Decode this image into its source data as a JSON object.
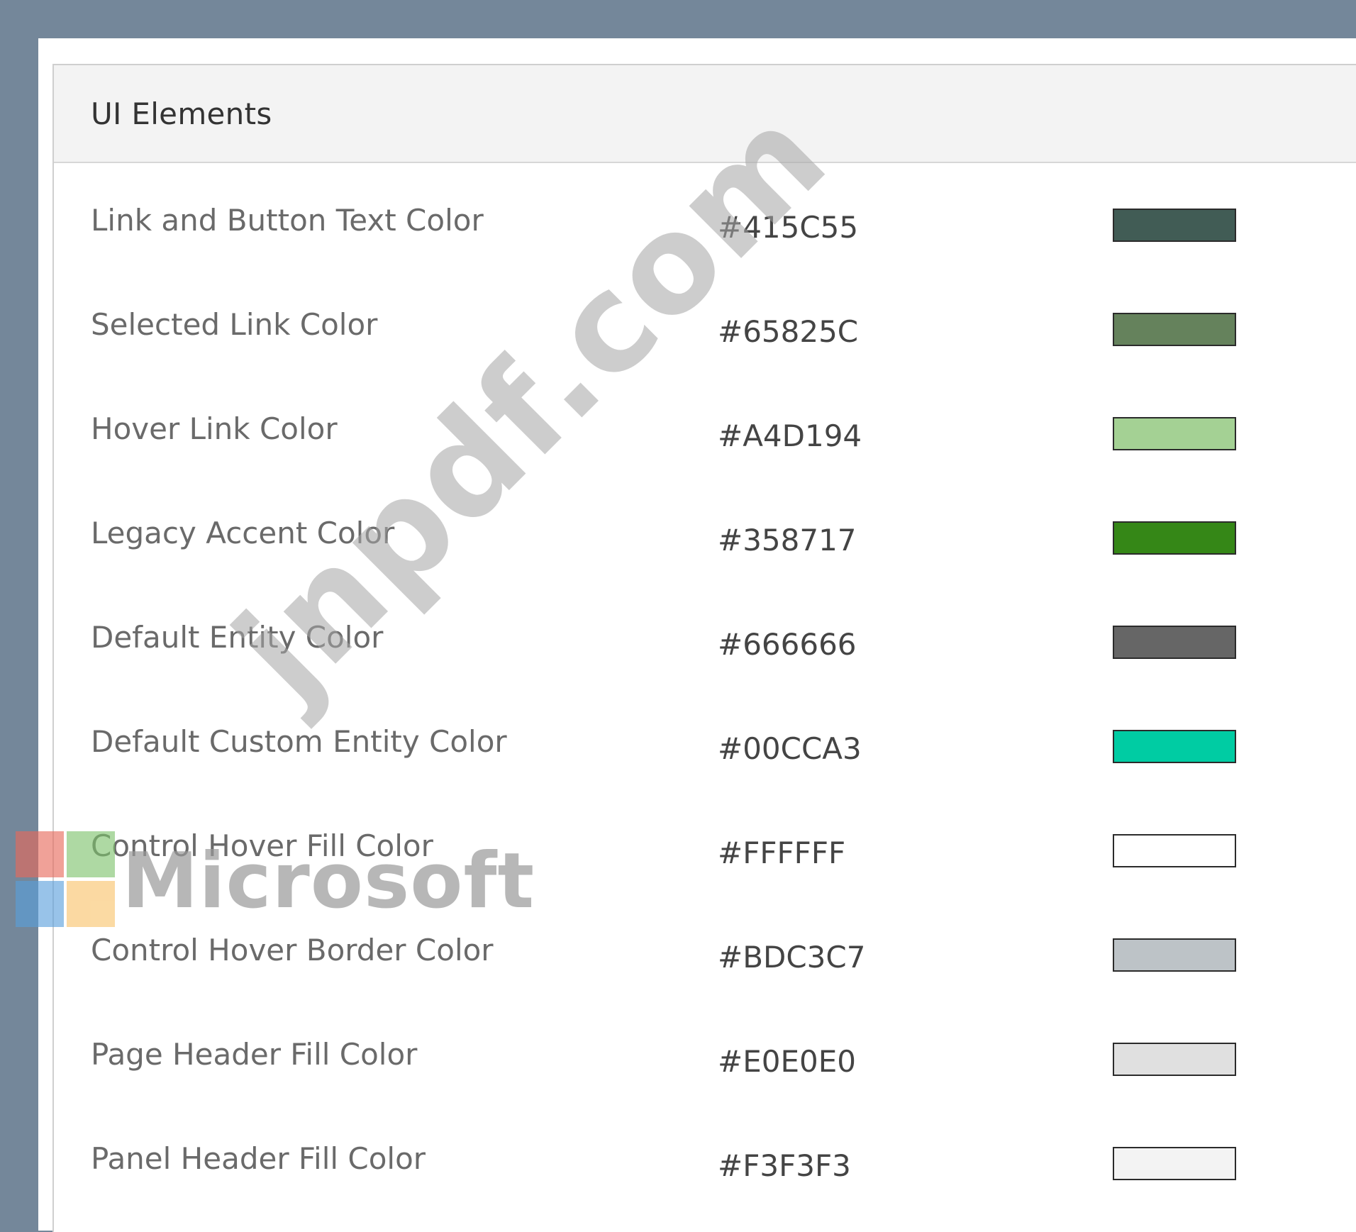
{
  "panel": {
    "title": "UI Elements"
  },
  "rows": [
    {
      "label": "Link and Button Text Color",
      "hex": "#415C55",
      "color": "#415C55"
    },
    {
      "label": "Selected Link Color",
      "hex": "#65825C",
      "color": "#65825C"
    },
    {
      "label": "Hover Link Color",
      "hex": "#A4D194",
      "color": "#A4D194"
    },
    {
      "label": "Legacy Accent Color",
      "hex": "#358717",
      "color": "#358717"
    },
    {
      "label": "Default Entity Color",
      "hex": "#666666",
      "color": "#666666"
    },
    {
      "label": "Default Custom Entity Color",
      "hex": "#00CCA3",
      "color": "#00CCA3"
    },
    {
      "label": "Control Hover Fill Color",
      "hex": "#FFFFFF",
      "color": "#FFFFFF"
    },
    {
      "label": "Control Hover Border Color",
      "hex": "#BDC3C7",
      "color": "#BDC3C7"
    },
    {
      "label": "Page Header Fill Color",
      "hex": "#E0E0E0",
      "color": "#E0E0E0"
    },
    {
      "label": "Panel Header Fill Color",
      "hex": "#F3F3F3",
      "color": "#F3F3F3"
    }
  ],
  "watermarks": {
    "site": "jnpdf.com",
    "brand": "Microsoft",
    "logo_colors": [
      "#E8695A",
      "#7DC36B",
      "#5AA0DC",
      "#F9C36A"
    ]
  }
}
